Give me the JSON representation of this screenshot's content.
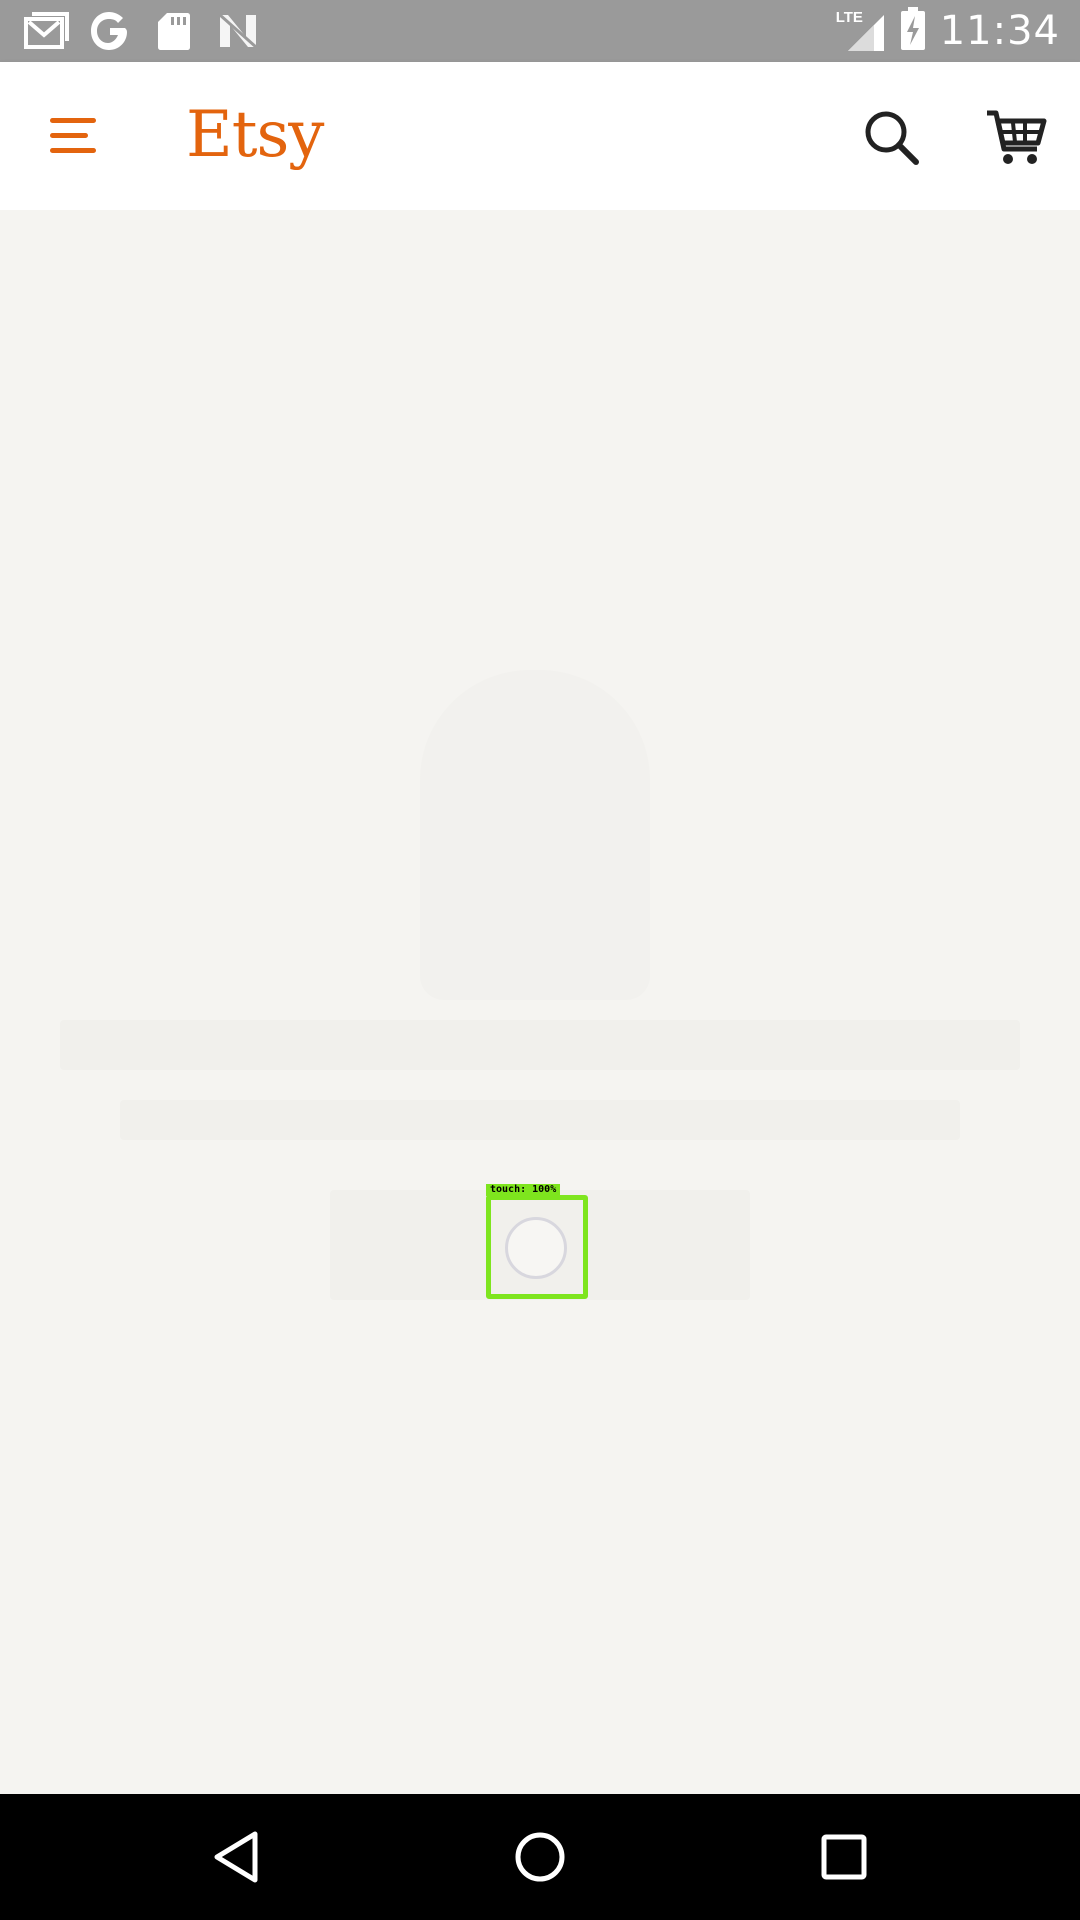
{
  "status_bar": {
    "time": "11:34",
    "network": "LTE",
    "icons": [
      "gmail-icon",
      "google-icon",
      "sd-card-icon",
      "n-icon",
      "signal-icon",
      "battery-charging-icon"
    ]
  },
  "app_bar": {
    "logo_text": "Etsy",
    "brand_color": "#e3640e",
    "menu_icon": "menu-icon",
    "search_icon": "search-icon",
    "cart_icon": "cart-icon"
  },
  "overlay": {
    "touch_label": "touch: 100%",
    "color": "#7ee51e"
  },
  "loading": {
    "icon": "loading-spinner-icon"
  },
  "nav_bar": {
    "back_icon": "back-icon",
    "home_icon": "home-icon",
    "recents_icon": "recents-icon"
  }
}
